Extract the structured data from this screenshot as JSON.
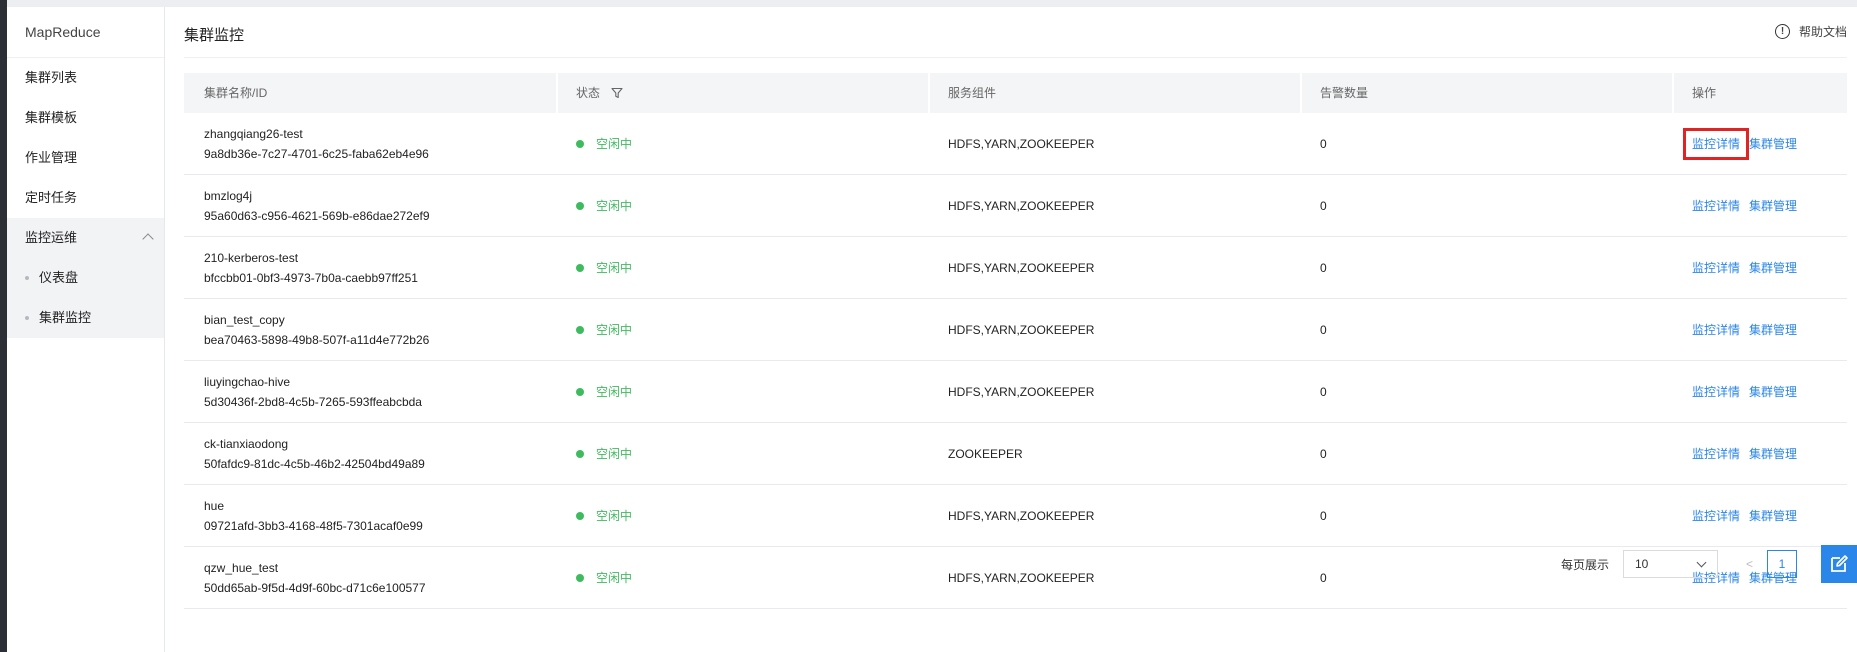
{
  "sidebar": {
    "title": "MapReduce",
    "items": [
      {
        "label": "集群列表"
      },
      {
        "label": "集群模板"
      },
      {
        "label": "作业管理"
      },
      {
        "label": "定时任务"
      }
    ],
    "group": {
      "label": "监控运维",
      "children": [
        {
          "label": "仪表盘"
        },
        {
          "label": "集群监控"
        }
      ]
    }
  },
  "header": {
    "title": "集群监控",
    "help_label": "帮助文档"
  },
  "table": {
    "columns": [
      "集群名称/ID",
      "状态",
      "服务组件",
      "告警数量",
      "操作"
    ],
    "rows": [
      {
        "name": "zhangqiang26-test",
        "id": "9a8db36e-7c27-4701-6c25-faba62eb4e96",
        "status": "空闲中",
        "components": "HDFS,YARN,ZOOKEEPER",
        "alerts": "0",
        "action_detail": "监控详情",
        "action_manage": "集群管理"
      },
      {
        "name": "bmzlog4j",
        "id": "95a60d63-c956-4621-569b-e86dae272ef9",
        "status": "空闲中",
        "components": "HDFS,YARN,ZOOKEEPER",
        "alerts": "0",
        "action_detail": "监控详情",
        "action_manage": "集群管理"
      },
      {
        "name": "210-kerberos-test",
        "id": "bfccbb01-0bf3-4973-7b0a-caebb97ff251",
        "status": "空闲中",
        "components": "HDFS,YARN,ZOOKEEPER",
        "alerts": "0",
        "action_detail": "监控详情",
        "action_manage": "集群管理"
      },
      {
        "name": "bian_test_copy",
        "id": "bea70463-5898-49b8-507f-a11d4e772b26",
        "status": "空闲中",
        "components": "HDFS,YARN,ZOOKEEPER",
        "alerts": "0",
        "action_detail": "监控详情",
        "action_manage": "集群管理"
      },
      {
        "name": "liuyingchao-hive",
        "id": "5d30436f-2bd8-4c5b-7265-593ffeabcbda",
        "status": "空闲中",
        "components": "HDFS,YARN,ZOOKEEPER",
        "alerts": "0",
        "action_detail": "监控详情",
        "action_manage": "集群管理"
      },
      {
        "name": "ck-tianxiaodong",
        "id": "50fafdc9-81dc-4c5b-46b2-42504bd49a89",
        "status": "空闲中",
        "components": "ZOOKEEPER",
        "alerts": "0",
        "action_detail": "监控详情",
        "action_manage": "集群管理"
      },
      {
        "name": "hue",
        "id": "09721afd-3bb3-4168-48f5-7301acaf0e99",
        "status": "空闲中",
        "components": "HDFS,YARN,ZOOKEEPER",
        "alerts": "0",
        "action_detail": "监控详情",
        "action_manage": "集群管理"
      },
      {
        "name": "qzw_hue_test",
        "id": "50dd65ab-9f5d-4d9f-60bc-d71c6e100577",
        "status": "空闲中",
        "components": "HDFS,YARN,ZOOKEEPER",
        "alerts": "0",
        "action_detail": "监控详情",
        "action_manage": "集群管理"
      }
    ]
  },
  "pagination": {
    "page_size_label": "每页展示",
    "page_size": "10",
    "prev": "<",
    "current_page": "1"
  },
  "colors": {
    "accent": "#2a86e8",
    "status_idle": "#3fbb5f",
    "highlight": "#e02424"
  },
  "icons": [
    "help-icon",
    "filter-icon",
    "chevron-up-icon",
    "chevron-down-icon",
    "edit-icon"
  ]
}
